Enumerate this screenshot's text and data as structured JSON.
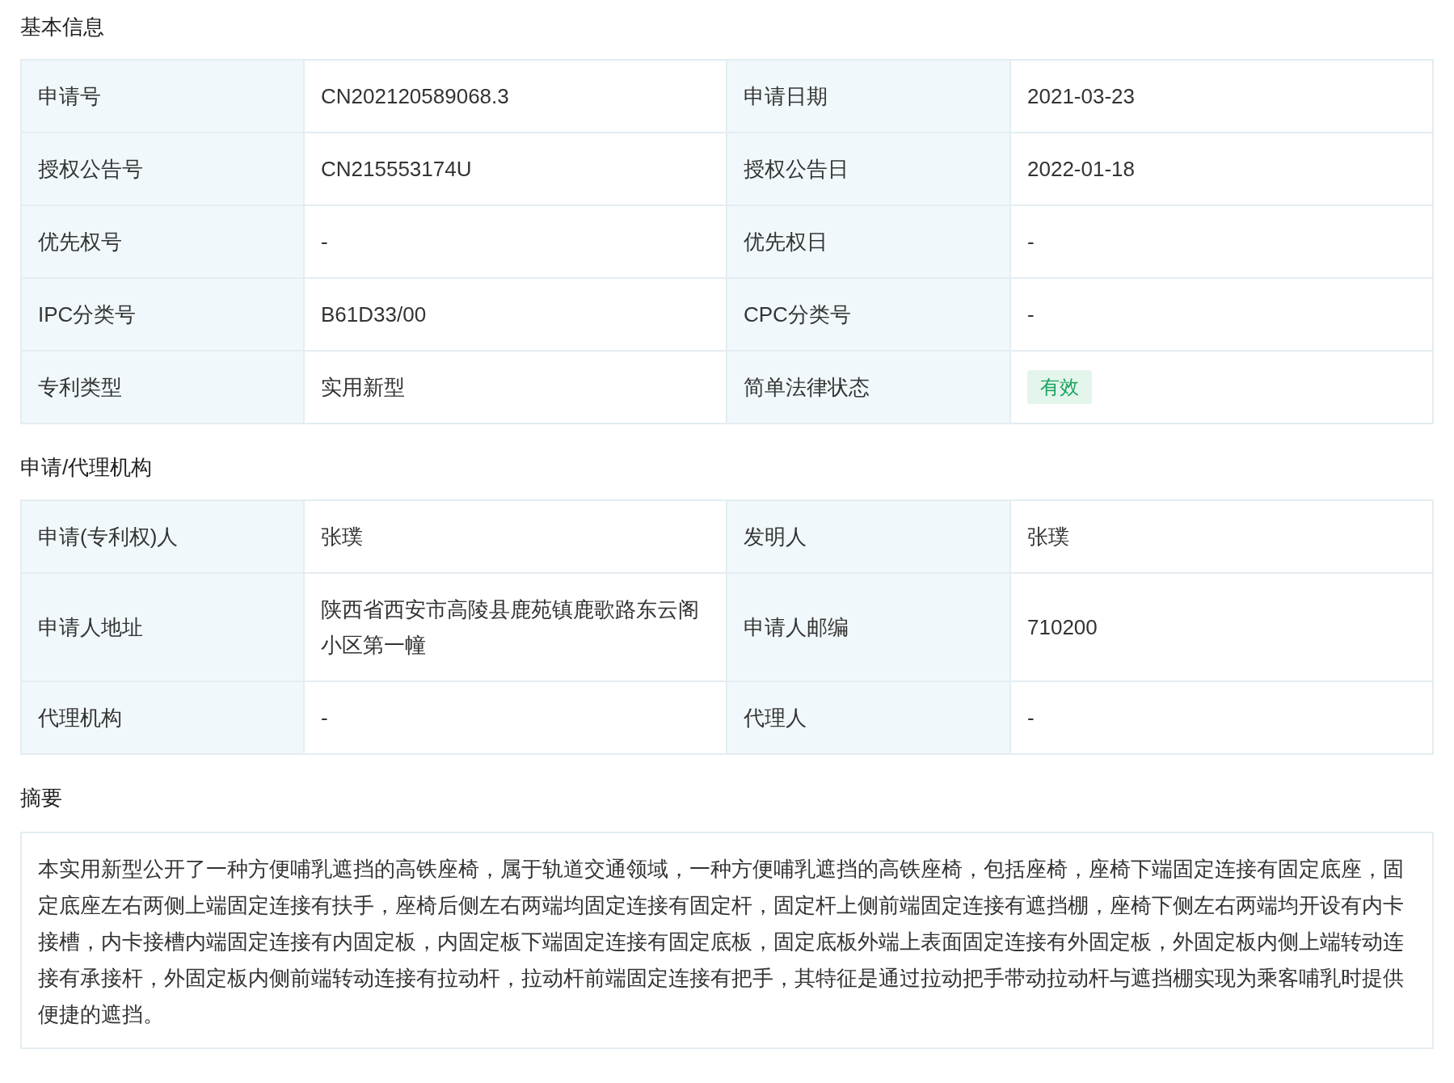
{
  "sections": [
    {
      "title": "基本信息",
      "kind": "table",
      "rows": [
        [
          {
            "label": "申请号",
            "value": "CN202120589068.3"
          },
          {
            "label": "申请日期",
            "value": "2021-03-23"
          }
        ],
        [
          {
            "label": "授权公告号",
            "value": "CN215553174U"
          },
          {
            "label": "授权公告日",
            "value": "2022-01-18"
          }
        ],
        [
          {
            "label": "优先权号",
            "value": "-"
          },
          {
            "label": "优先权日",
            "value": "-"
          }
        ],
        [
          {
            "label": "IPC分类号",
            "value": "B61D33/00"
          },
          {
            "label": "CPC分类号",
            "value": "-"
          }
        ],
        [
          {
            "label": "专利类型",
            "value": "实用新型"
          },
          {
            "label": "简单法律状态",
            "value": "有效",
            "kind": "tag"
          }
        ]
      ]
    },
    {
      "title": "申请/代理机构",
      "kind": "table",
      "rows": [
        [
          {
            "label": "申请(专利权)人",
            "value": "张璞"
          },
          {
            "label": "发明人",
            "value": "张璞"
          }
        ],
        [
          {
            "label": "申请人地址",
            "value": "陕西省西安市高陵县鹿苑镇鹿歌路东云阁小区第一幢"
          },
          {
            "label": "申请人邮编",
            "value": "710200"
          }
        ],
        [
          {
            "label": "代理机构",
            "value": "-"
          },
          {
            "label": "代理人",
            "value": "-"
          }
        ]
      ]
    },
    {
      "title": "摘要",
      "kind": "text",
      "text": "本实用新型公开了一种方便哺乳遮挡的高铁座椅，属于轨道交通领域，一种方便哺乳遮挡的高铁座椅，包括座椅，座椅下端固定连接有固定底座，固定底座左右两侧上端固定连接有扶手，座椅后侧左右两端均固定连接有固定杆，固定杆上侧前端固定连接有遮挡棚，座椅下侧左右两端均开设有内卡接槽，内卡接槽内端固定连接有内固定板，内固定板下端固定连接有固定底板，固定底板外端上表面固定连接有外固定板，外固定板内侧上端转动连接有承接杆，外固定板内侧前端转动连接有拉动杆，拉动杆前端固定连接有把手，其特征是通过拉动把手带动拉动杆与遮挡棚实现为乘客哺乳时提供便捷的遮挡。"
    }
  ]
}
